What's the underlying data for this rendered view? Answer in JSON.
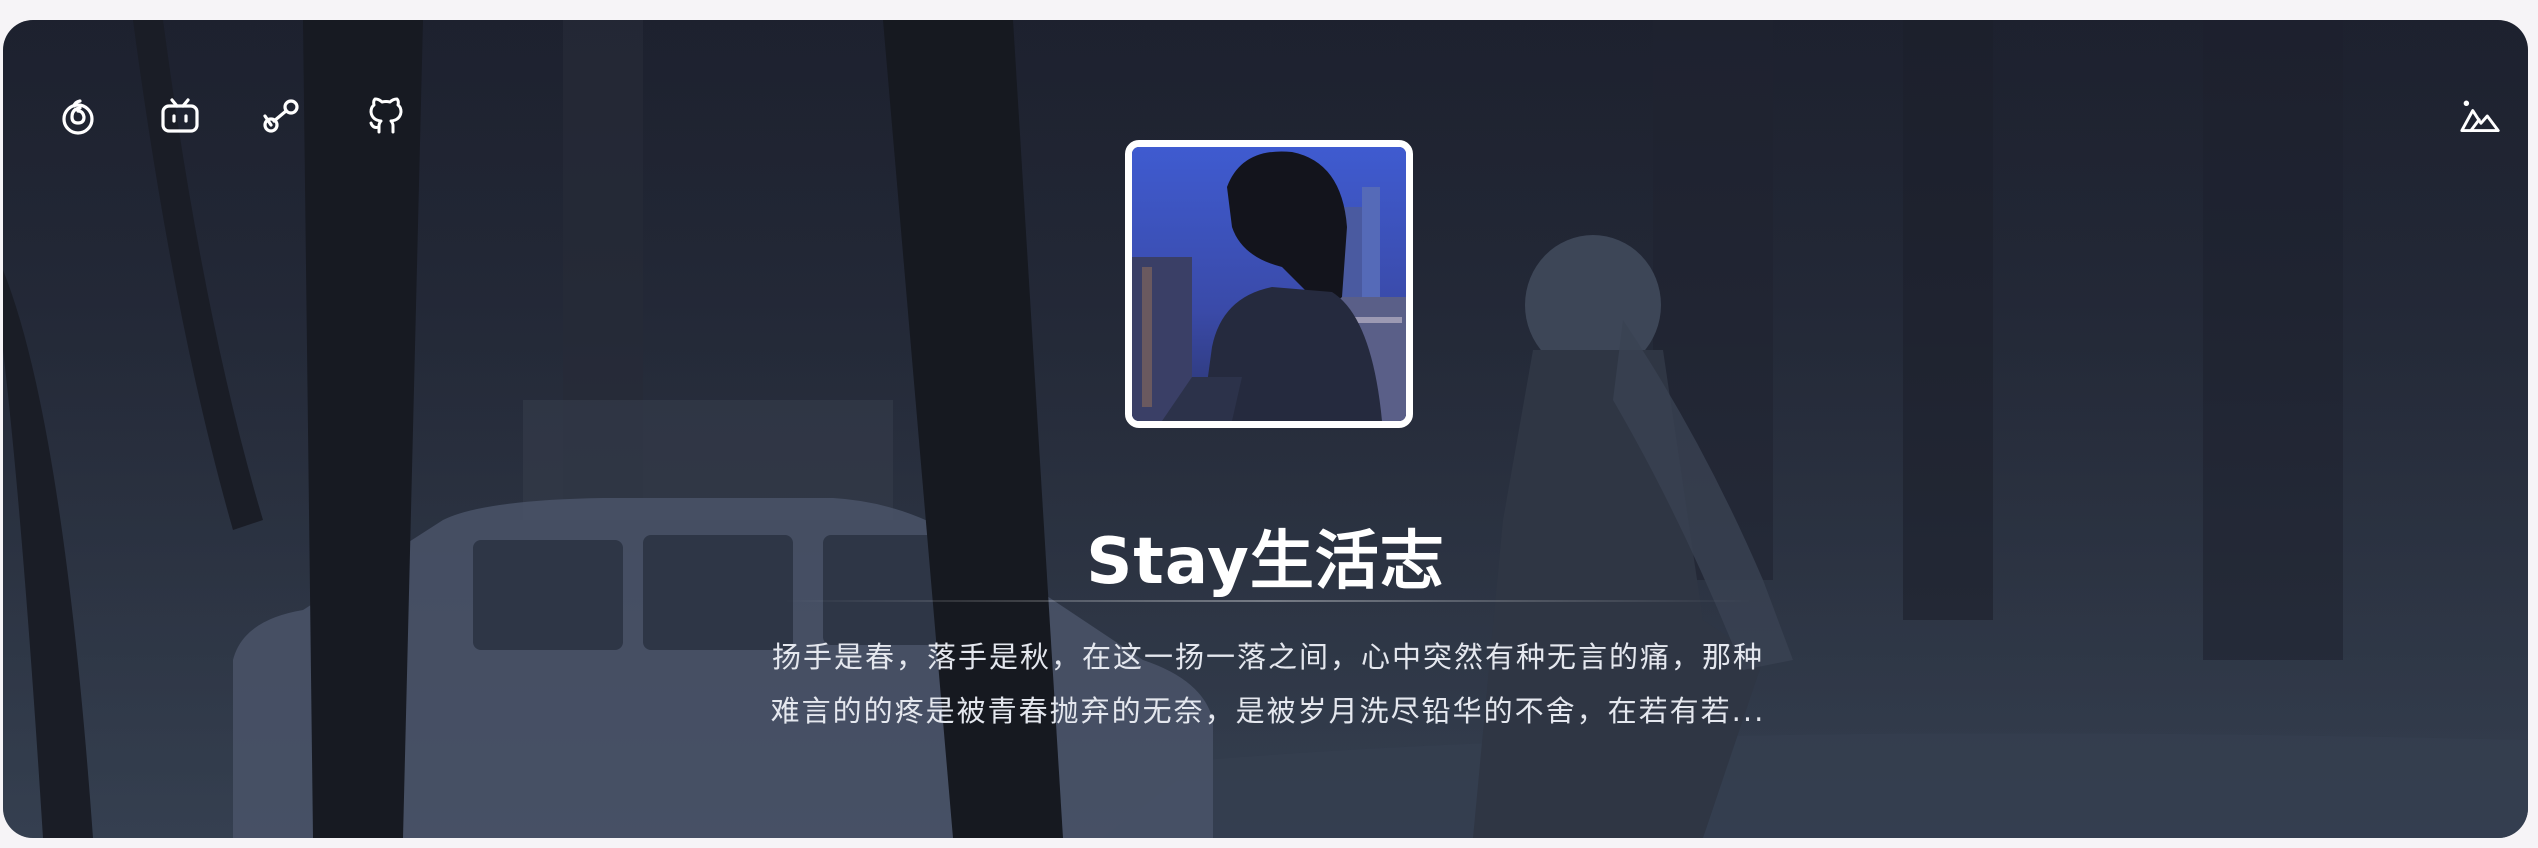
{
  "profile": {
    "title": "Stay生活志",
    "description_line1": "扬手是春，落手是秋，在这一扬一落之间，心中突然有种无言的痛，那种",
    "description_line2": "难言的的疼是被青春抛弃的无奈，是被岁月洗尽铅华的不舍，在若有若..."
  },
  "social_links": [
    {
      "name": "netease-music-icon"
    },
    {
      "name": "bilibili-icon"
    },
    {
      "name": "steam-icon"
    },
    {
      "name": "github-icon"
    }
  ],
  "toolbar": {
    "wallpaper_icon": "mountain-image-icon"
  },
  "colors": {
    "card_bg": "#222736",
    "title": "#ffffff",
    "avatar_border": "#ffffff"
  }
}
